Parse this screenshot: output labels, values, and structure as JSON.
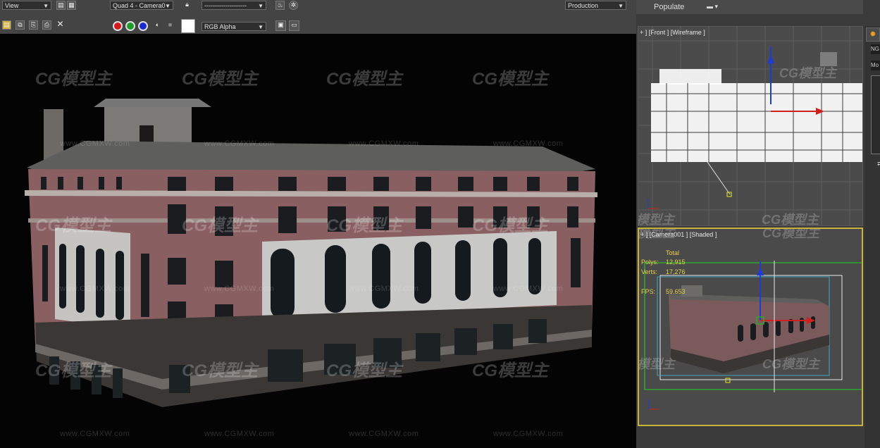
{
  "toolbar": {
    "view_select": "View",
    "viewport_select": "Quad 4 - Camera0",
    "preset_select": "--------------------",
    "render_mode_select": "Production",
    "channel_select": "RGB Alpha"
  },
  "right_panel": {
    "populate_label": "Populate",
    "front_viewport_label": "+ ] [Front ] [Wireframe ]",
    "camera_viewport_label": "+ ] [Camera001 ] [Shaded ]",
    "stats": {
      "total_label": "Total",
      "polys_label": "Polys:",
      "polys_value": "12,915",
      "verts_label": "Verts:",
      "verts_value": "17,276",
      "fps_label": "FPS:",
      "fps_value": "59.653"
    },
    "side_labels": [
      "NG",
      "Mo"
    ]
  },
  "watermark": {
    "logo_text": "CG模型主",
    "url": "www.CGMXW.com"
  },
  "colors": {
    "toolbar_bg": "#444444",
    "render_bg": "#040404",
    "viewport_bg": "#4a4a4a",
    "active_viewport_border": "#c8b23a",
    "building_pink": "#8a5f62",
    "building_white": "#c8c8c6"
  },
  "icons": [
    "save-icon",
    "copy-icon",
    "clone-icon",
    "print-icon",
    "clear-icon",
    "lock-icon",
    "teapot-icon",
    "render-icon",
    "red-channel-icon",
    "green-channel-icon",
    "blue-channel-icon",
    "alpha-icon",
    "mono-icon",
    "background-swatch",
    "overlay-icon",
    "display-icon"
  ]
}
